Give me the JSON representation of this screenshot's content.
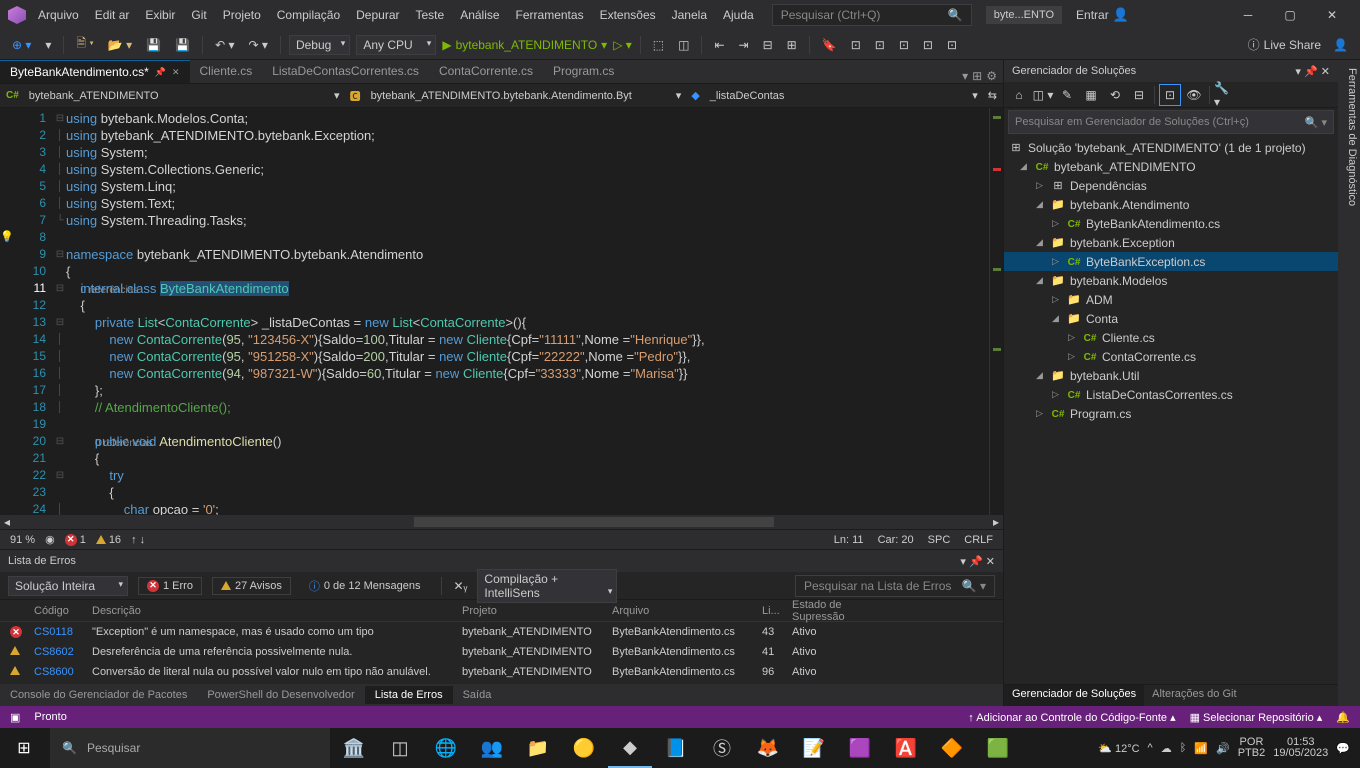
{
  "menu": [
    "Arquivo",
    "Edit ar",
    "Exibir",
    "Git",
    "Projeto",
    "Compilação",
    "Depurar",
    "Teste",
    "Análise",
    "Ferramentas",
    "Extensões",
    "Janela",
    "Ajuda"
  ],
  "search_placeholder": "Pesquisar (Ctrl+Q)",
  "project_badge": "byte...ENTO",
  "signin": "Entrar",
  "toolbar": {
    "config": "Debug",
    "platform": "Any CPU",
    "start": "bytebank_ATENDIMENTO",
    "liveshare": "Live Share"
  },
  "tabs": [
    {
      "label": "ByteBankAtendimento.cs*",
      "active": true
    },
    {
      "label": "Cliente.cs",
      "active": false
    },
    {
      "label": "ListaDeContasCorrentes.cs",
      "active": false
    },
    {
      "label": "ContaCorrente.cs",
      "active": false
    },
    {
      "label": "Program.cs",
      "active": false
    }
  ],
  "nav": {
    "left": "bytebank_ATENDIMENTO",
    "mid": "bytebank_ATENDIMENTO.bytebank.Atendimento.Byt",
    "right": "_listaDeContas"
  },
  "editor_status": {
    "zoom": "91 %",
    "errors": "1",
    "warnings": "16",
    "ln": "Ln: 11",
    "car": "Car: 20",
    "ins": "SPC",
    "enc": "CRLF"
  },
  "error_panel": {
    "title": "Lista de Erros",
    "scope": "Solução Inteira",
    "err_toggle": "1 Erro",
    "wrn_toggle": "27 Avisos",
    "msg_toggle": "0 de 12 Mensagens",
    "build_combo": "Compilação + IntelliSens",
    "search": "Pesquisar na Lista de Erros",
    "headers": {
      "code": "Código",
      "desc": "Descrição",
      "proj": "Projeto",
      "file": "Arquivo",
      "line": "Li...",
      "state": "Estado de Supressão"
    },
    "rows": [
      {
        "icon": "err",
        "code": "CS0118",
        "desc": "\"Exception\" é um namespace, mas é usado como um tipo",
        "proj": "bytebank_ATENDIMENTO",
        "file": "ByteBankAtendimento.cs",
        "line": "43",
        "state": "Ativo"
      },
      {
        "icon": "wrn",
        "code": "CS8602",
        "desc": "Desreferência de uma referência possivelmente nula.",
        "proj": "bytebank_ATENDIMENTO",
        "file": "ByteBankAtendimento.cs",
        "line": "41",
        "state": "Ativo"
      },
      {
        "icon": "wrn",
        "code": "CS8600",
        "desc": "Conversão de literal nula ou possível valor nulo em tipo não anulável.",
        "proj": "bytebank_ATENDIMENTO",
        "file": "ByteBankAtendimento.cs",
        "line": "96",
        "state": "Ativo"
      }
    ]
  },
  "bottom_tabs": [
    "Console do Gerenciador de Pacotes",
    "PowerShell do Desenvolvedor",
    "Lista de Erros",
    "Saída"
  ],
  "solution": {
    "title": "Gerenciador de Soluções",
    "search": "Pesquisar em Gerenciador de Soluções (Ctrl+ç)",
    "root": "Solução 'bytebank_ATENDIMENTO' (1 de 1 projeto)",
    "tree": [
      {
        "d": 1,
        "exp": "◢",
        "icon": "proj",
        "label": "bytebank_ATENDIMENTO"
      },
      {
        "d": 2,
        "exp": "▷",
        "icon": "dep",
        "label": "Dependências"
      },
      {
        "d": 2,
        "exp": "◢",
        "icon": "fld",
        "label": "bytebank.Atendimento"
      },
      {
        "d": 3,
        "exp": "▷",
        "icon": "cs",
        "label": "ByteBankAtendimento.cs"
      },
      {
        "d": 2,
        "exp": "◢",
        "icon": "fld",
        "label": "bytebank.Exception"
      },
      {
        "d": 3,
        "exp": "▷",
        "icon": "cs",
        "label": "ByteBankException.cs",
        "sel": true
      },
      {
        "d": 2,
        "exp": "◢",
        "icon": "fld",
        "label": "bytebank.Modelos"
      },
      {
        "d": 3,
        "exp": "▷",
        "icon": "fld",
        "label": "ADM"
      },
      {
        "d": 3,
        "exp": "◢",
        "icon": "fld",
        "label": "Conta"
      },
      {
        "d": 4,
        "exp": "▷",
        "icon": "cs",
        "label": "Cliente.cs"
      },
      {
        "d": 4,
        "exp": "▷",
        "icon": "cs",
        "label": "ContaCorrente.cs"
      },
      {
        "d": 2,
        "exp": "◢",
        "icon": "fld",
        "label": "bytebank.Util"
      },
      {
        "d": 3,
        "exp": "▷",
        "icon": "cs",
        "label": "ListaDeContasCorrentes.cs"
      },
      {
        "d": 2,
        "exp": "▷",
        "icon": "cs",
        "label": "Program.cs"
      }
    ],
    "bottom_tabs": [
      "Gerenciador de Soluções",
      "Alterações do Git"
    ]
  },
  "right_rail": "Ferramentas de Diagnóstico",
  "statusbar": {
    "ready": "Pronto",
    "source": "Adicionar ao Controle do Código-Fonte",
    "repo": "Selecionar Repositório"
  },
  "taskbar": {
    "search": "Pesquisar",
    "weather": "12°C",
    "lang1": "POR",
    "lang2": "PTB2",
    "time": "01:53",
    "date": "19/05/2023"
  },
  "refs": "0 referências"
}
